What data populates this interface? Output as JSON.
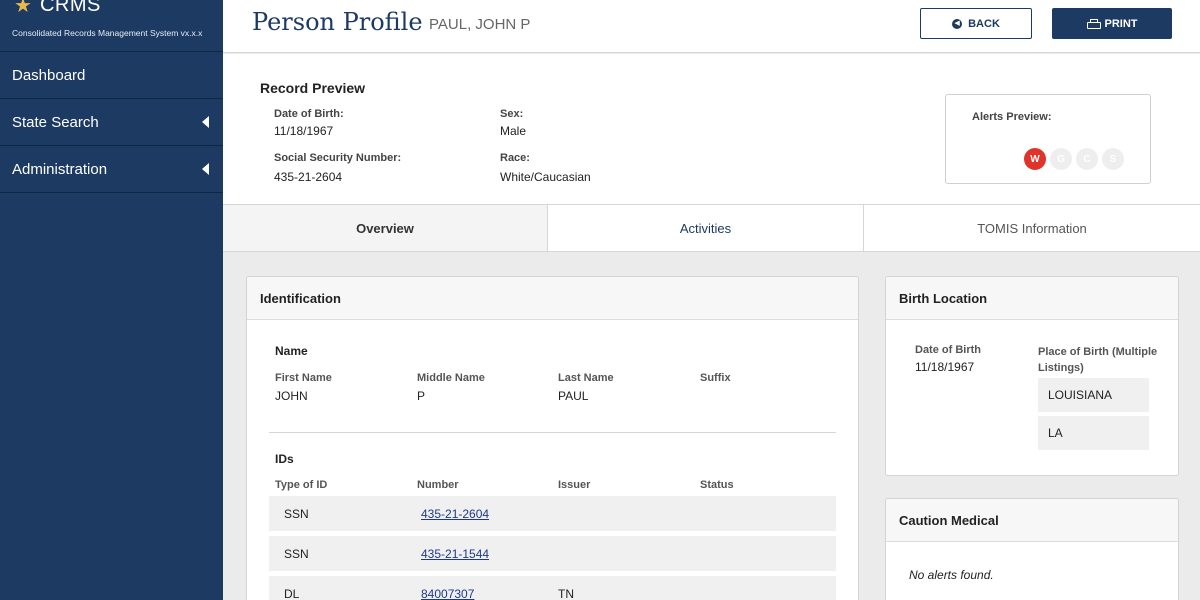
{
  "app": {
    "brand": "CRMS",
    "subtitle": "Consolidated Records Management System vx.x.x"
  },
  "sidebar": {
    "items": [
      {
        "label": "Dashboard",
        "has_submenu": false
      },
      {
        "label": "State Search",
        "has_submenu": true
      },
      {
        "label": "Administration",
        "has_submenu": true
      }
    ]
  },
  "header": {
    "title": "Person Profile",
    "subtitle": "PAUL, JOHN P",
    "back_label": "BACK",
    "print_label": "PRINT"
  },
  "record_preview": {
    "title": "Record Preview",
    "dob_label": "Date of Birth:",
    "dob_value": "11/18/1967",
    "ssn_label": "Social Security Number:",
    "ssn_value": "435-21-2604",
    "sex_label": "Sex:",
    "sex_value": "Male",
    "race_label": "Race:",
    "race_value": "White/Caucasian",
    "alerts": {
      "title": "Alerts Preview:",
      "badges": [
        {
          "letter": "W",
          "active": true
        },
        {
          "letter": "G",
          "active": false
        },
        {
          "letter": "C",
          "active": false
        },
        {
          "letter": "S",
          "active": false
        }
      ]
    }
  },
  "tabs": [
    {
      "label": "Overview",
      "active": true
    },
    {
      "label": "Activities",
      "active": false
    },
    {
      "label": "TOMIS Information",
      "active": false
    }
  ],
  "identification": {
    "title": "Identification",
    "name_section": "Name",
    "name_columns": [
      "First Name",
      "Middle Name",
      "Last Name",
      "Suffix"
    ],
    "name_values": [
      "JOHN",
      "P",
      "PAUL",
      ""
    ],
    "ids_section": "IDs",
    "id_columns": [
      "Type of ID",
      "Number",
      "Issuer",
      "Status"
    ],
    "id_rows": [
      {
        "type": "SSN",
        "number": "435-21-2604",
        "issuer": "",
        "status": ""
      },
      {
        "type": "SSN",
        "number": "435-21-1544",
        "issuer": "",
        "status": ""
      },
      {
        "type": "DL",
        "number": "84007307",
        "issuer": "TN",
        "status": ""
      }
    ]
  },
  "birth_location": {
    "title": "Birth Location",
    "dob_label": "Date of Birth",
    "dob_value": "11/18/1967",
    "pob_label": "Place of Birth (Multiple Listings)",
    "pob_values": [
      "LOUISIANA",
      "LA"
    ]
  },
  "caution_medical": {
    "title": "Caution Medical",
    "message": "No alerts found."
  },
  "colors": {
    "primary": "#1d3a63",
    "alert_active": "#e0342a",
    "link": "#1d3a8a"
  }
}
